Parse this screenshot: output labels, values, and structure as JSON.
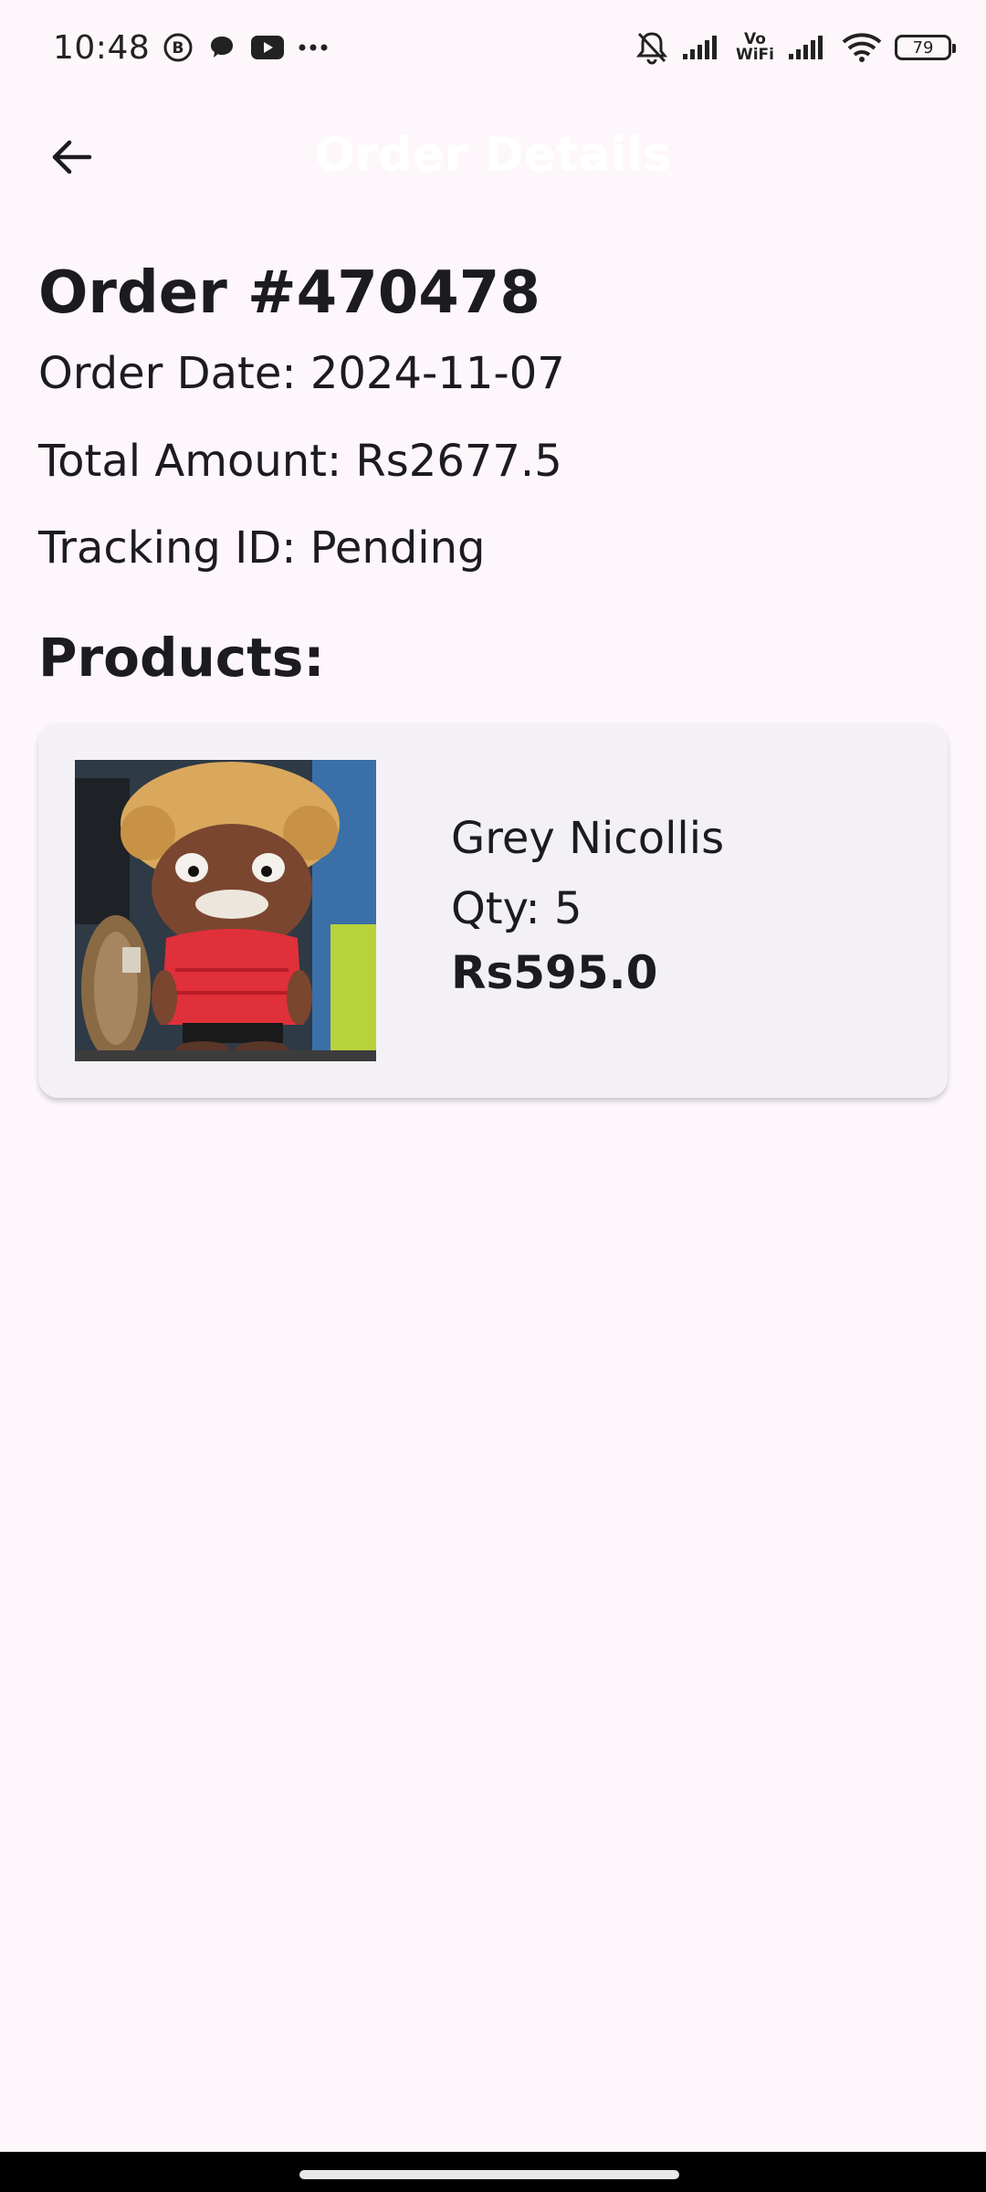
{
  "status_bar": {
    "time": "10:48",
    "battery": "79",
    "vowifi_top": "Vo",
    "vowifi_bottom": "WiFi",
    "notification_icons": [
      "b-circle-icon",
      "chat-bubble-icon",
      "youtube-icon",
      "more-dots-icon"
    ],
    "system_icons": [
      "bell-off-icon",
      "signal-icon",
      "vowifi-icon",
      "signal-icon",
      "wifi-icon",
      "battery-icon"
    ]
  },
  "app_bar": {
    "title": "Order Details",
    "back_icon": "arrow-left-icon"
  },
  "order": {
    "number": "Order #470478",
    "date": "Order Date: 2024-11-07",
    "total": "Total Amount: Rs2677.5",
    "tracking": "Tracking ID: Pending"
  },
  "products_heading": "Products:",
  "products": [
    {
      "name": "Grey Nicollis",
      "qty": "Qty: 5",
      "price": "Rs595.0"
    }
  ],
  "colors": {
    "background": "#FDF7FC",
    "card": "#F4F1F6",
    "text": "#1C1B1F"
  }
}
